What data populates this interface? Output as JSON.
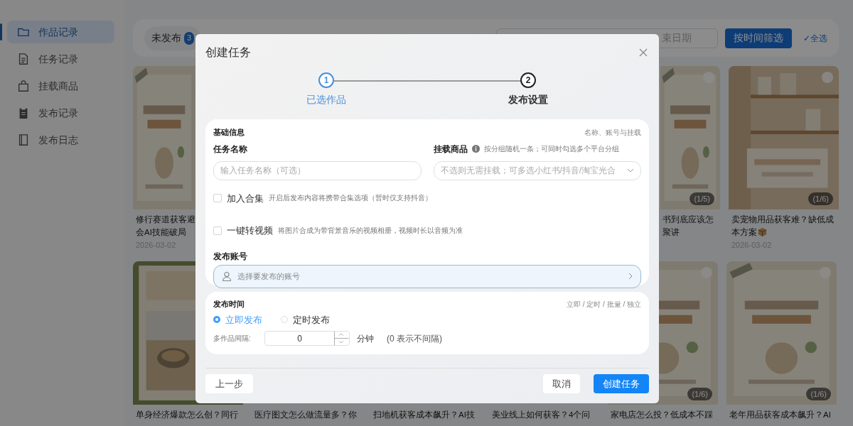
{
  "sidebar": {
    "items": [
      {
        "label": "作品记录",
        "selected": true
      },
      {
        "label": "任务记录",
        "selected": false
      },
      {
        "label": "挂载商品",
        "selected": false
      },
      {
        "label": "发布记录",
        "selected": false
      },
      {
        "label": "发布日志",
        "selected": false
      }
    ]
  },
  "toolbar": {
    "tab": {
      "label": "未发布",
      "count": "3"
    },
    "date_end_placeholder": "束日期",
    "filter_button": "按时间筛选",
    "select_all": "✓全选"
  },
  "card_rows": [
    {
      "start": [
        {
          "image": {
            "kind": "picture"
          },
          "title_lines": [
            "修行赛道获客避",
            "会AI技能破局"
          ],
          "date": "2026-03-02"
        }
      ],
      "end": [
        {
          "image": {
            "kind": "picture",
            "badge": "(1/5)"
          },
          "title_lines": [
            "书到底应该怎",
            "聚讲"
          ]
        },
        {
          "image": {
            "kind": "picture",
            "badge": "(1/6)"
          },
          "title_lines": [
            "卖宠物用品获客难？缺低成",
            "本方案"
          ],
          "box_icon": true,
          "date": "2026-03-02"
        }
      ]
    },
    {
      "start": [
        {
          "image": {
            "kind": "picture"
          },
          "title_lines": [
            "单身经济爆款怎么创？同行"
          ]
        },
        {
          "title_lines": [
            "医疗图文怎么做流量多？你"
          ]
        },
        {
          "title_lines": [
            "扫地机获客成本飙升？AI技"
          ]
        },
        {
          "title_lines": [
            "美业线上如何获客？4个问"
          ]
        },
        {
          "image": {
            "kind": "picture",
            "badge": "(1/6)"
          },
          "title_lines": [
            "家电店怎么投？低成本不踩"
          ]
        },
        {
          "image": {
            "kind": "picture",
            "badge": "(1/6)"
          },
          "title_lines": [
            "老年用品获客成本飙升？AI"
          ]
        }
      ]
    }
  ],
  "dialog": {
    "title": "创建任务",
    "steps": [
      {
        "number": "1",
        "label": "已选作品",
        "current": false
      },
      {
        "number": "2",
        "label": "发布设置",
        "current": true
      }
    ],
    "basic": {
      "heading": "基础信息",
      "hint": "名称、账号与挂载",
      "name_label": "任务名称",
      "name_placeholder": "输入任务名称（可选）",
      "goods_label": "挂载商品",
      "goods_hint": "按分组随机一条；可同时勾选多个平台分组",
      "goods_placeholder": "不选则无需挂载；可多选小红书/抖音/淘宝光合",
      "options": [
        {
          "label": "加入合集",
          "hint": "开启后发布内容将携带合集选项（暂时仅支持抖音）",
          "checked": false
        },
        {
          "label": "一键转视频",
          "hint": "将图片合成为带背景音乐的视频相册，视频时长以音频为准",
          "checked": false
        }
      ],
      "account_label": "发布账号",
      "account_placeholder": "选择要发布的账号"
    },
    "timing": {
      "heading": "发布时间",
      "hint": "立即 / 定时 / 批量 / 独立",
      "modes": [
        {
          "label": "立即发布",
          "selected": true
        },
        {
          "label": "定时发布",
          "selected": false
        }
      ],
      "interval_label": "多作品间隔:",
      "interval_value": "0",
      "interval_unit": "分钟",
      "interval_note": "(0 表示不间隔)"
    },
    "buttons": {
      "back": "上一步",
      "cancel": "取消",
      "create": "创建任务"
    }
  }
}
